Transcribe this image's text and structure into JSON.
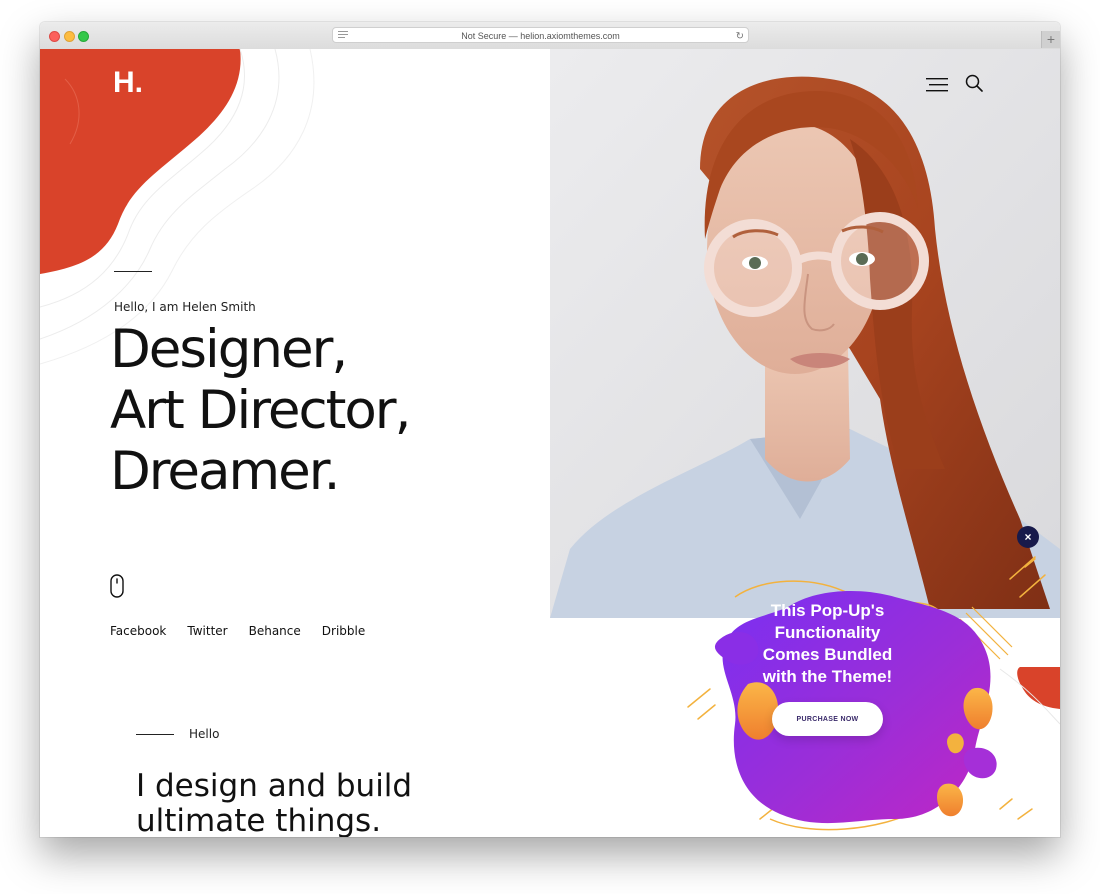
{
  "browser": {
    "url": "Not Secure — helion.axiomthemes.com",
    "new_tab": "+"
  },
  "site": {
    "logo": "H.",
    "hero": {
      "greeting": "Hello, I am Helen Smith",
      "headline_lines": [
        "Designer,",
        "Art Director,",
        "Dreamer."
      ]
    },
    "social_links": [
      "Facebook",
      "Twitter",
      "Behance",
      "Dribble"
    ],
    "section": {
      "label": "Hello",
      "title_lines": [
        "I design and build",
        "ultimate things."
      ]
    }
  },
  "popup": {
    "title": "This Pop-Up's Functionality Comes Bundled with the Theme!",
    "button": "PURCHASE NOW",
    "close": "×"
  },
  "colors": {
    "accent": "#d9432a",
    "popup_purple": "#8d2de0",
    "popup_orange": "#f4a53d",
    "close_navy": "#171a4b"
  },
  "icons": [
    "lines-icon",
    "reload-icon",
    "menu-icon",
    "search-icon",
    "mouse-icon",
    "close-icon"
  ]
}
